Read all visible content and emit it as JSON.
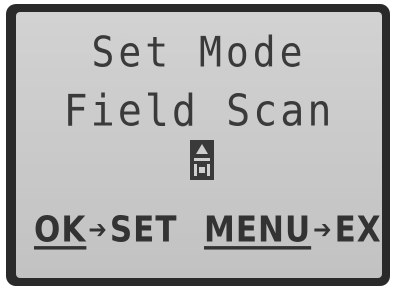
{
  "screen": {
    "title": "Set Mode",
    "subtitle": "Field Scan",
    "mode_icon": "camera-trap-icon"
  },
  "footer": {
    "ok_key": "OK",
    "ok_arrow": "➔",
    "ok_action": "SET",
    "menu_key": "MENU",
    "menu_arrow": "➔",
    "menu_action": "EXiT"
  }
}
